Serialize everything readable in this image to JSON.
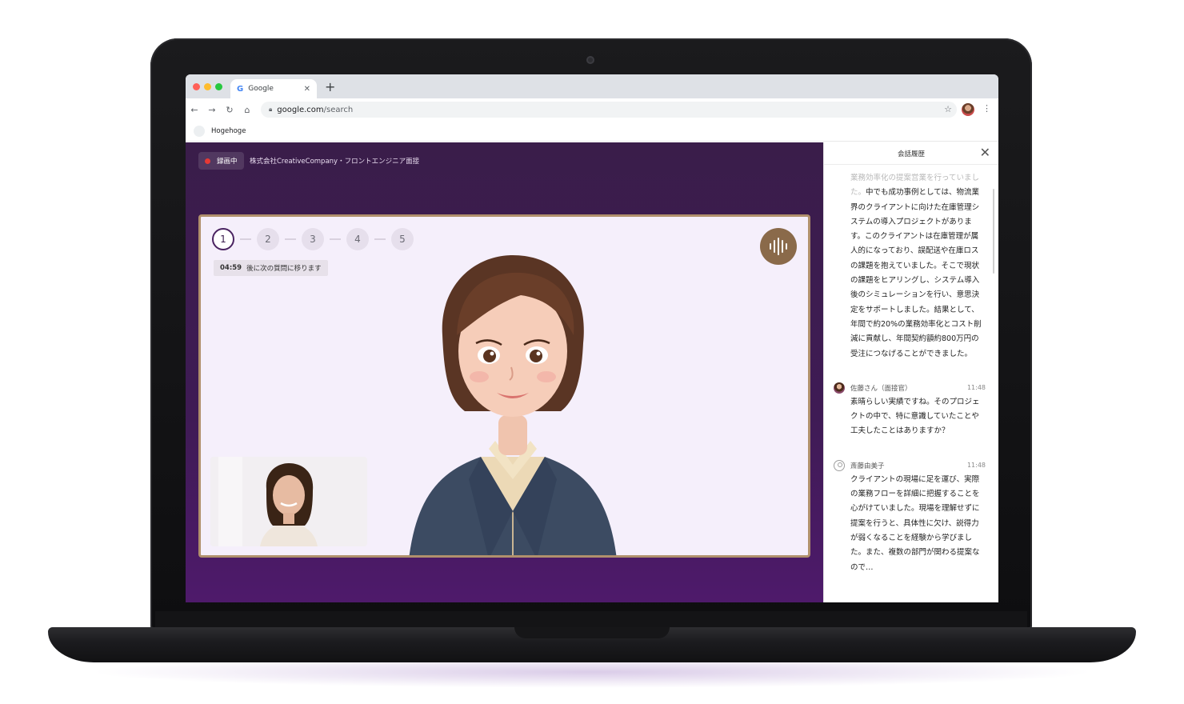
{
  "browser": {
    "tab_title": "Google",
    "url_host": "google.com",
    "url_path": "/search",
    "bookmark_label": "Hogehoge"
  },
  "header": {
    "status_label": "録画中",
    "title": "株式会社CreativeCompany・フロントエンジニア面接"
  },
  "steps": [
    "1",
    "2",
    "3",
    "4",
    "5"
  ],
  "active_step": 1,
  "timer": {
    "time": "04:59",
    "suffix": "後に次の質問に移ります"
  },
  "panel": {
    "title": "会話履歴",
    "intro_faded": "業務効率化の提案営業を行っていました。",
    "intro_text": "中でも成功事例としては、物流業界のクライアントに向けた在庫管理システムの導入プロジェクトがあります。このクライアントは在庫管理が属人的になっており、誤配送や在庫ロスの課題を抱えていました。そこで現状の課題をヒアリングし、システム導入後のシミュレーションを行い、意思決定をサポートしました。結果として、年間で約20%の業務効率化とコスト削減に貢献し、年間契約額約800万円の受注につなげることができました。",
    "messages": [
      {
        "name": "佐藤さん（面接官）",
        "time": "11:48",
        "text": "素晴らしい実績ですね。そのプロジェクトの中で、特に意識していたことや工夫したことはありますか？"
      },
      {
        "name": "斎藤由美子",
        "time": "11:48",
        "text": "クライアントの現場に足を運び、実際の業務フローを詳細に把握することを心がけていました。現場を理解せずに提案を行うと、具体性に欠け、説得力が弱くなることを経験から学びました。また、複数の部門が関わる提案なので…"
      }
    ]
  },
  "colors": {
    "app_bg": "#3f1b55",
    "stage_border": "#b0906c",
    "voice_button": "#8a6a4a",
    "rec_dot": "#e53935"
  }
}
